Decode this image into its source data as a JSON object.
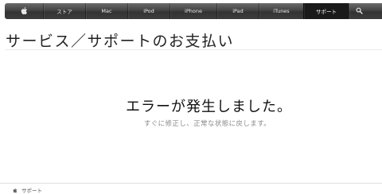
{
  "nav": {
    "items": [
      {
        "label": "ストア"
      },
      {
        "label": "Mac"
      },
      {
        "label": "iPod"
      },
      {
        "label": "iPhone"
      },
      {
        "label": "iPad"
      },
      {
        "label": "iTunes"
      },
      {
        "label": "サポート",
        "active": true
      }
    ],
    "logo_icon": "apple-logo-icon",
    "search_icon": "search-icon"
  },
  "page": {
    "title": "サービス／サポートのお支払い"
  },
  "error": {
    "heading": "エラーが発生しました。",
    "message": "すぐに修正し、正常な状態に戻します。"
  },
  "footer": {
    "breadcrumb_label": "サポート"
  },
  "colors": {
    "nav_background": "#3c3c3c",
    "nav_active": "#1a1a1a",
    "message_text": "#8a8a8a"
  }
}
